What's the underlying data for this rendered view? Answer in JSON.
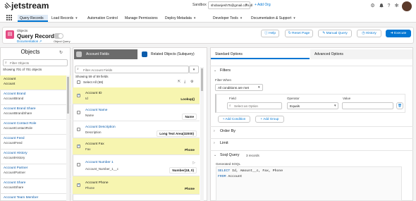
{
  "header": {
    "logo_text": "jetstream",
    "org_label": "Sandbox",
    "org_value": "shobanjesh75@gmail.com.dl",
    "add_org": "+ Add Org",
    "icons": [
      "settings-icon",
      "bell-icon",
      "help-icon",
      "gear-icon"
    ]
  },
  "nav": {
    "items": [
      {
        "label": "Query Records",
        "active": true,
        "caret": false
      },
      {
        "label": "Load Records",
        "active": false,
        "caret": true
      },
      {
        "label": "Automation Control",
        "active": false,
        "caret": false
      },
      {
        "label": "Manage Permissions",
        "active": false,
        "caret": false
      },
      {
        "label": "Deploy Metadata",
        "active": false,
        "caret": true
      },
      {
        "label": "Developer Tools",
        "active": false,
        "caret": true
      },
      {
        "label": "Documentation & Support",
        "active": false,
        "caret": true
      }
    ]
  },
  "subheader": {
    "small": "Objects",
    "title": "Query Records",
    "doc": "Documentation",
    "toggle_label": "Object Query",
    "buttons": {
      "help": "Help",
      "reset": "Reset Page",
      "manual": "Manual Query",
      "history": "History",
      "execute": "Execute"
    }
  },
  "objects": {
    "title": "Objects",
    "filter_placeholder": "Filter Objects",
    "count": "Showing 701 of 701 objects",
    "items": [
      {
        "name": "Account",
        "api": "Account",
        "selected": true
      },
      {
        "name": "Account Brand",
        "api": "AccountBrand",
        "selected": false
      },
      {
        "name": "Account Brand Share",
        "api": "AccountBrandShare",
        "selected": false
      },
      {
        "name": "Account Contact Role",
        "api": "AccountContactRole",
        "selected": false
      },
      {
        "name": "Account Feed",
        "api": "AccountFeed",
        "selected": false
      },
      {
        "name": "Account History",
        "api": "AccountHistory",
        "selected": false
      },
      {
        "name": "Account Partner",
        "api": "AccountPartner",
        "selected": false
      },
      {
        "name": "Account Share",
        "api": "AccountShare",
        "selected": false
      },
      {
        "name": "Account Team Member",
        "api": "AccountTeamMember",
        "selected": false
      }
    ]
  },
  "fields": {
    "tab_active": "Account Fields",
    "tab_other": "Related Objects (Subquery)",
    "filter_placeholder": "Filter Account Fields",
    "count": "Showing 59 of 59 fields",
    "select_all": "Select All (59)",
    "items": [
      {
        "name": "Account ID",
        "api": "Id",
        "type": "Lookup()",
        "selected": true
      },
      {
        "name": "Account Name",
        "api": "Name",
        "type": "Name",
        "selected": false
      },
      {
        "name": "Account Description",
        "api": "Description",
        "type": "Long Text Area(32000)",
        "selected": false
      },
      {
        "name": "Account Fax",
        "api": "Fax",
        "type": "Phone",
        "selected": true
      },
      {
        "name": "Account Number 1",
        "api": "Account_Number_1__c",
        "type": "Number(18, 0)",
        "selected": false
      },
      {
        "name": "Account Phone",
        "api": "Phone",
        "type": "Phone",
        "selected": true
      }
    ]
  },
  "options": {
    "tab_active": "Standard Options",
    "tab_other": "Advanced Options",
    "filters_title": "Filters",
    "filter_when_label": "Filter When",
    "filter_when_value": "All conditions are met",
    "field_label": "Field",
    "operator_label": "Operator",
    "value_label": "Value",
    "field_placeholder": "Select an Option",
    "operator_value": "Equals",
    "add_condition": "Add Condition",
    "add_group": "Add Group",
    "order_by": "Order By",
    "limit": "Limit",
    "soql_title": "Soql Query",
    "soql_count": "3 records",
    "generated": "Generated SOQL",
    "soql_line1_kw": "SELECT",
    "soql_line1_rest": " Id, Amount__c, Fax, Phone",
    "soql_line2_kw": "FROM",
    "soql_line2_rest": " Account"
  },
  "colors": {
    "accent": "#0176d3",
    "selected_row": "#f7f5b0",
    "object_icon": "#e44a82"
  }
}
